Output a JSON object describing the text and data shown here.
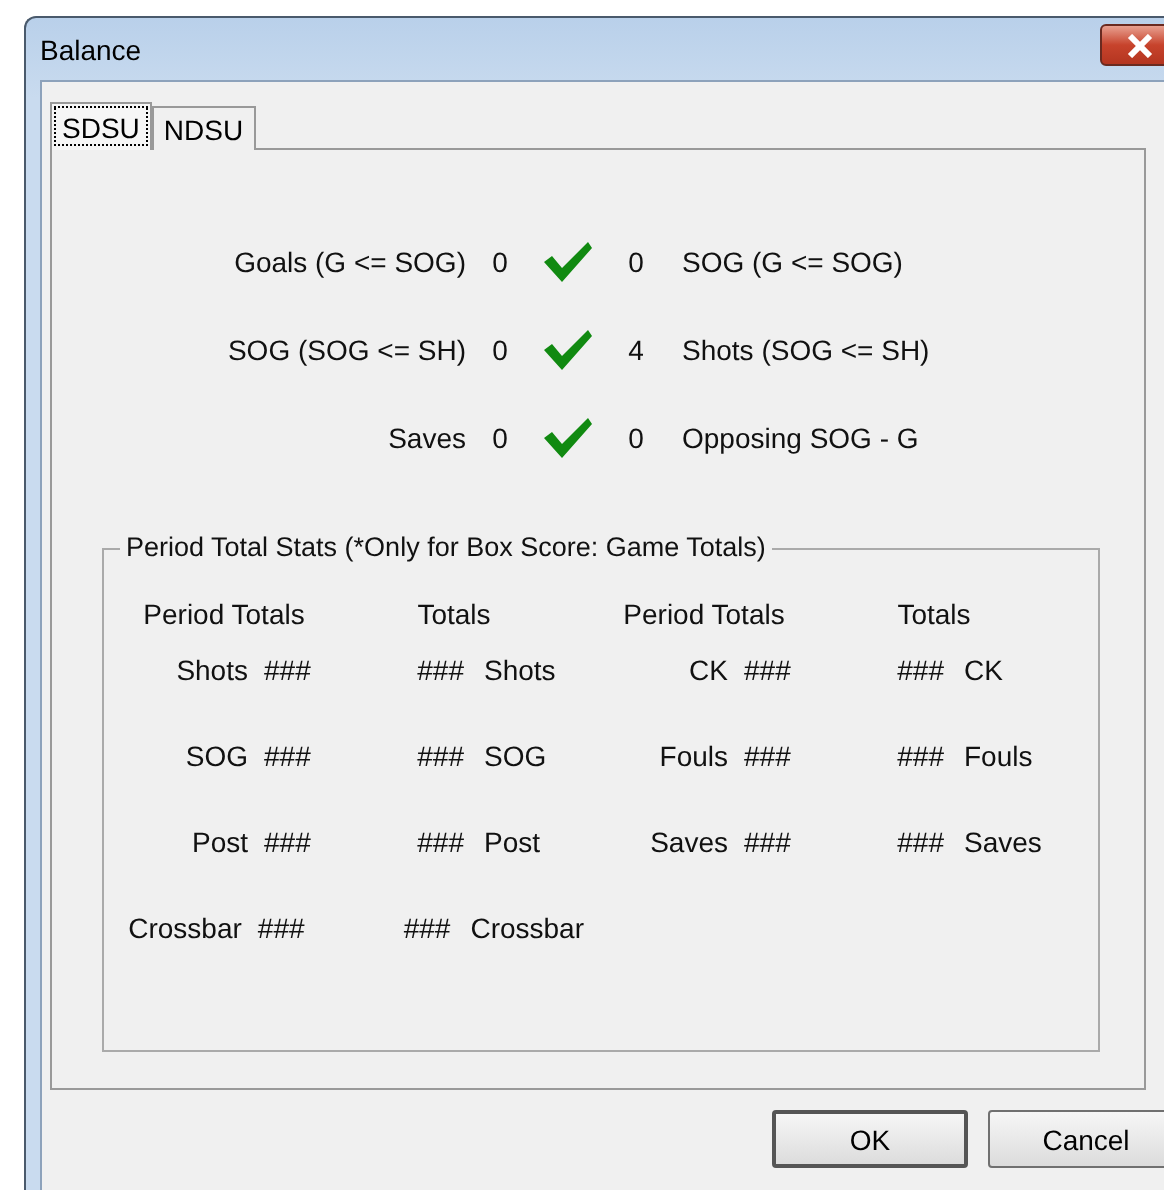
{
  "window": {
    "title": "Balance"
  },
  "tabs": [
    {
      "label": "SDSU",
      "selected": true
    },
    {
      "label": "NDSU",
      "selected": false
    }
  ],
  "balance": [
    {
      "left_label": "Goals (G <= SOG)",
      "left_value": "0",
      "balanced": true,
      "right_value": "0",
      "right_label": "SOG (G <= SOG)"
    },
    {
      "left_label": "SOG (SOG <= SH)",
      "left_value": "0",
      "balanced": true,
      "right_value": "4",
      "right_label": "Shots (SOG <= SH)"
    },
    {
      "left_label": "Saves",
      "left_value": "0",
      "balanced": true,
      "right_value": "0",
      "right_label": "Opposing SOG - G"
    }
  ],
  "period_stats": {
    "title": "Period Total Stats (*Only for Box Score: Game Totals)",
    "sections": [
      {
        "period_header": "Period Totals",
        "total_header": "Totals",
        "rows": [
          {
            "period_label": "Shots",
            "period_value": "###",
            "total_value": "###",
            "total_label": "Shots"
          },
          {
            "period_label": "SOG",
            "period_value": "###",
            "total_value": "###",
            "total_label": "SOG"
          },
          {
            "period_label": "Post",
            "period_value": "###",
            "total_value": "###",
            "total_label": "Post"
          },
          {
            "period_label": "Crossbar",
            "period_value": "###",
            "total_value": "###",
            "total_label": "Crossbar"
          }
        ]
      },
      {
        "period_header": "Period Totals",
        "total_header": "Totals",
        "rows": [
          {
            "period_label": "CK",
            "period_value": "###",
            "total_value": "###",
            "total_label": "CK"
          },
          {
            "period_label": "Fouls",
            "period_value": "###",
            "total_value": "###",
            "total_label": "Fouls"
          },
          {
            "period_label": "Saves",
            "period_value": "###",
            "total_value": "###",
            "total_label": "Saves"
          }
        ]
      }
    ]
  },
  "buttons": [
    "OK",
    "Cancel"
  ]
}
